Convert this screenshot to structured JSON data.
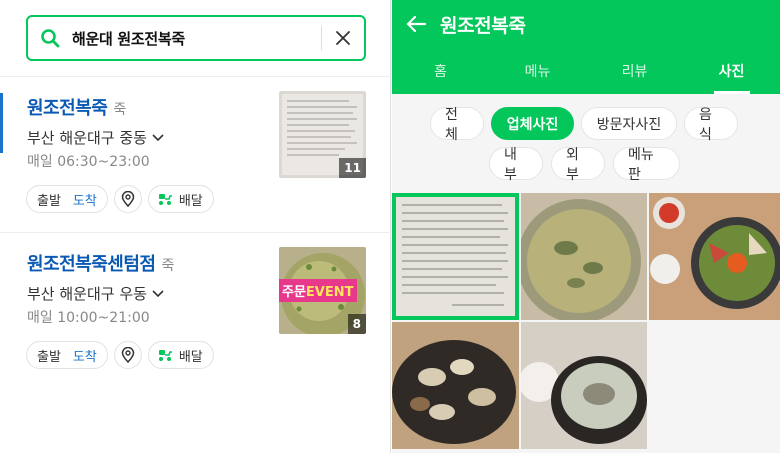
{
  "search": {
    "query": "해운대 원조전복죽"
  },
  "results": [
    {
      "name": "원조전복죽",
      "category": "죽",
      "address": "부산 해운대구 중동",
      "hours": "매일 06:30~23:00",
      "depart_label": "출발",
      "arrive_label": "도착",
      "delivery_label": "배달",
      "photo_count": "11"
    },
    {
      "name": "원조전복죽센텀점",
      "category": "죽",
      "address": "부산 해운대구 우동",
      "hours": "매일 10:00~21:00",
      "depart_label": "출발",
      "arrive_label": "도착",
      "delivery_label": "배달",
      "photo_count": "8",
      "badge_prefix": "주문",
      "badge_event": "EVENT"
    }
  ],
  "detail": {
    "title": "원조전복죽",
    "tabs": [
      "홈",
      "메뉴",
      "리뷰",
      "사진"
    ],
    "active_tab": "사진",
    "filters": [
      "전체",
      "업체사진",
      "방문자사진",
      "음식",
      "내부",
      "외부",
      "메뉴판"
    ],
    "active_filter": "업체사진"
  },
  "colors": {
    "brand_green": "#03c75a",
    "link_blue": "#0a5ab5",
    "event_pink": "#e8388c"
  }
}
